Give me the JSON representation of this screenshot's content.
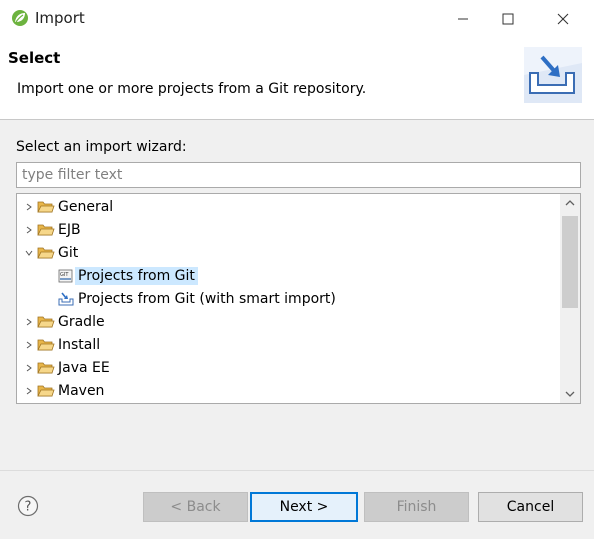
{
  "window": {
    "title": "Import"
  },
  "header": {
    "title": "Select",
    "description": "Import one or more projects from a Git repository."
  },
  "wizard": {
    "label": "Select an import wizard:",
    "filter_placeholder": "type filter text",
    "filter_value": ""
  },
  "tree": {
    "items": [
      {
        "label": "General",
        "type": "folder",
        "expanded": false
      },
      {
        "label": "EJB",
        "type": "folder",
        "expanded": false
      },
      {
        "label": "Git",
        "type": "folder",
        "expanded": true
      },
      {
        "label": "Projects from Git",
        "type": "leaf",
        "selected": true
      },
      {
        "label": "Projects from Git (with smart import)",
        "type": "leaf",
        "selected": false
      },
      {
        "label": "Gradle",
        "type": "folder",
        "expanded": false
      },
      {
        "label": "Install",
        "type": "folder",
        "expanded": false
      },
      {
        "label": "Java EE",
        "type": "folder",
        "expanded": false
      },
      {
        "label": "Maven",
        "type": "folder",
        "expanded": false
      }
    ]
  },
  "buttons": {
    "back": "< Back",
    "next": "Next >",
    "finish": "Finish",
    "cancel": "Cancel"
  },
  "colors": {
    "selection": "#cce8ff",
    "default_button_border": "#0078d7",
    "folder": "#e8b64a"
  }
}
